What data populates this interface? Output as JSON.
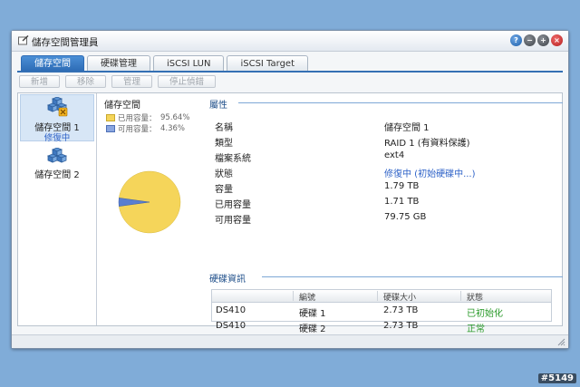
{
  "window": {
    "title": "儲存空間管理員"
  },
  "window_buttons": [
    "?",
    "−",
    "+",
    "×"
  ],
  "tabs": [
    {
      "label": "儲存空間",
      "active": true
    },
    {
      "label": "硬碟管理",
      "active": false
    },
    {
      "label": "iSCSI LUN",
      "active": false
    },
    {
      "label": "iSCSI Target",
      "active": false
    }
  ],
  "toolbar": {
    "create": "新增",
    "remove": "移除",
    "manage": "管理",
    "stop_scrub": "停止偵錯"
  },
  "volumes": [
    {
      "name": "儲存空間 1",
      "status": "修復中",
      "selected": true
    },
    {
      "name": "儲存空間 2",
      "status": "",
      "selected": false
    }
  ],
  "usage": {
    "title": "儲存空間",
    "used_label": "已用容量：",
    "used_pct": "95.64%",
    "free_label": "可用容量：",
    "free_pct": "4.36%",
    "used_color": "#f5d55a",
    "free_color": "#5a7ed0"
  },
  "chart_data": {
    "type": "pie",
    "title": "",
    "labels": [
      "已用容量",
      "可用容量"
    ],
    "values": [
      95.64,
      4.36
    ],
    "colors": [
      "#f5d55a",
      "#5a7ed0"
    ]
  },
  "properties": {
    "section_title": "屬性",
    "rows": [
      {
        "label": "名稱",
        "value": "儲存空間 1",
        "link": false
      },
      {
        "label": "類型",
        "value": "RAID 1 (有資料保護)",
        "link": false
      },
      {
        "label": "檔案系統",
        "value": "ext4",
        "link": false
      },
      {
        "label": "狀態",
        "value": "修復中 (初始硬碟中...)",
        "link": true
      },
      {
        "label": "容量",
        "value": "1.79 TB",
        "link": false
      },
      {
        "label": "已用容量",
        "value": "1.71 TB",
        "link": false
      },
      {
        "label": "可用容量",
        "value": "79.75 GB",
        "link": false
      }
    ]
  },
  "disk_info": {
    "section_title": "硬碟資訊",
    "headers": [
      "",
      "編號",
      "硬碟大小",
      "狀態"
    ],
    "rows": [
      {
        "model": "DS410",
        "number": "硬碟 1",
        "size": "2.73 TB",
        "status": "已初始化"
      },
      {
        "model": "DS410",
        "number": "硬碟 2",
        "size": "2.73 TB",
        "status": "正常"
      }
    ],
    "status_color": "#2a9a2a"
  },
  "watermark": "#5149"
}
